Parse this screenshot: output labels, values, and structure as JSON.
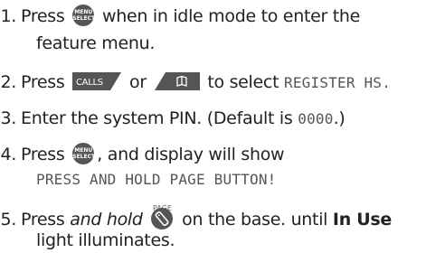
{
  "steps": [
    {
      "num": "1.",
      "before": "Press",
      "button_lines": [
        "MENU",
        "SELECT"
      ],
      "after": "when in idle mode to enter the",
      "continuation": "feature menu."
    },
    {
      "num": "2.",
      "before": "Press",
      "calls_label": "CALLS",
      "or": "or",
      "after": "to select",
      "lcd": "REGISTER HS."
    },
    {
      "num": "3.",
      "text": "Enter the system PIN. (Default is",
      "pin": "0000",
      "tail": ".)"
    },
    {
      "num": "4.",
      "before": "Press",
      "button_lines": [
        "MENU",
        "SELECT"
      ],
      "after": ", and display will show",
      "lcd": "PRESS AND HOLD PAGE BUTTON!"
    },
    {
      "num": "5.",
      "before": "Press",
      "italic": "and hold",
      "page_label": "PAGE",
      "middle": "on the base. until",
      "bold": "In Use",
      "continuation": "light illuminates."
    }
  ],
  "colors": {
    "button_fill": "#555555",
    "lcd_text": "#555555",
    "text": "#222222"
  },
  "icons": [
    "menu-select-button-icon",
    "calls-tab-icon",
    "phonebook-tab-icon",
    "page-button-icon"
  ]
}
